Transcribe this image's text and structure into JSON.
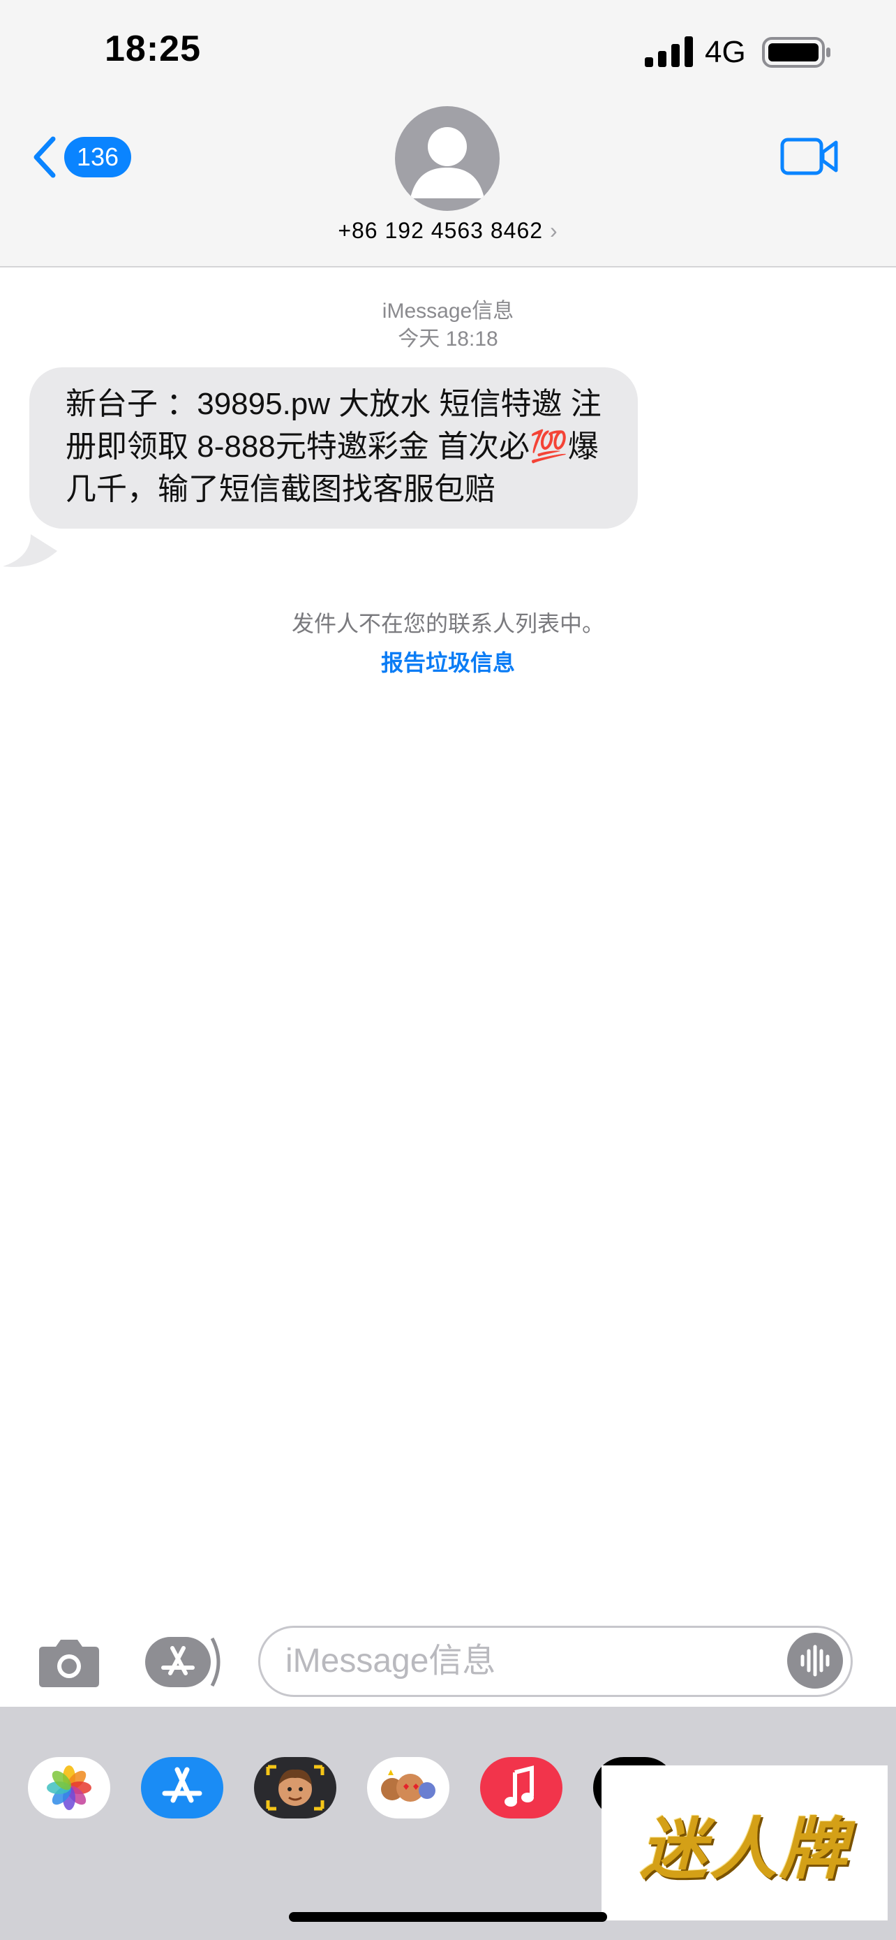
{
  "status_bar": {
    "time": "18:25",
    "network": "4G"
  },
  "header": {
    "back_count": "136",
    "contact": "+86 192 4563 8462",
    "chevron": "›"
  },
  "thread": {
    "service": "iMessage信息",
    "timestamp": "今天 18:18",
    "message": "新台子 ：39895.pw  大放水 短信特邀 注册即领取 8-888元特邀彩金 首次必💯爆几千，输了短信截图找客服包赔",
    "notice": "发件人不在您的联系人列表中。",
    "report_link": "报告垃圾信息"
  },
  "composer": {
    "placeholder": "iMessage信息"
  },
  "drawer": {
    "apps": [
      "photos-app",
      "app-store-app",
      "memoji-app",
      "animoji-app",
      "music-app",
      "more-app"
    ]
  },
  "watermark": {
    "text": "迷人牌"
  },
  "colors": {
    "accent": "#0a84ff",
    "bubble": "#e9e9eb",
    "header_bg": "#f5f5f5",
    "drawer_bg": "#d1d1d6"
  }
}
